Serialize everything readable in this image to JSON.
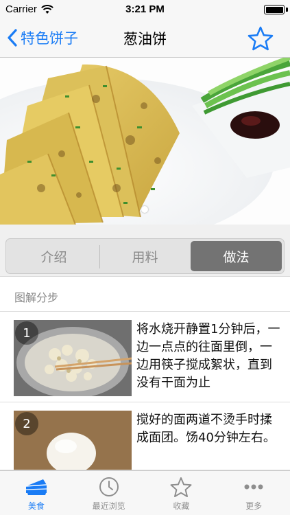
{
  "status_bar": {
    "carrier": "Carrier",
    "time": "3:21 PM"
  },
  "nav": {
    "back_label": "特色饼子",
    "title": "葱油饼",
    "accent_color": "#1a7cf5"
  },
  "hero": {
    "page_count": 1,
    "current_page": 1
  },
  "segments": {
    "items": [
      "介绍",
      "用料",
      "做法"
    ],
    "selected": "做法"
  },
  "section": {
    "title": "图解分步"
  },
  "steps": [
    {
      "number": "1",
      "text": "将水烧开静置1分钟后，一边一点点的往面里倒，一边用筷子搅成絮状，直到没有干面为止"
    },
    {
      "number": "2",
      "text": "搅好的面两道不烫手时揉成面团。饧40分钟左右。"
    }
  ],
  "tab_bar": {
    "items": [
      {
        "label": "美食",
        "icon": "cake-icon"
      },
      {
        "label": "最近浏览",
        "icon": "clock-icon"
      },
      {
        "label": "收藏",
        "icon": "star-icon"
      },
      {
        "label": "更多",
        "icon": "more-icon"
      }
    ],
    "active": "美食"
  }
}
